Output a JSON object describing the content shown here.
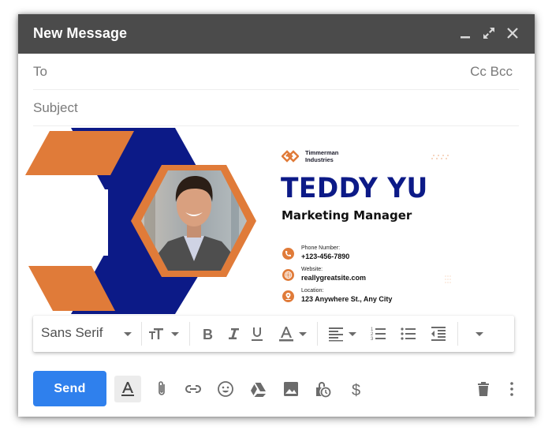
{
  "window": {
    "title": "New Message",
    "controls": [
      "minimize",
      "expand",
      "close"
    ]
  },
  "compose": {
    "to_label": "To",
    "cc_bcc_label": "Cc Bcc",
    "subject_label": "Subject"
  },
  "signature": {
    "company_line1": "Timmerman",
    "company_line2": "Industries",
    "name": "TEDDY YU",
    "role": "Marketing Manager",
    "contacts": [
      {
        "icon": "phone-icon",
        "label": "Phone Number:",
        "value": "+123-456-7890"
      },
      {
        "icon": "globe-icon",
        "label": "Website:",
        "value": "reallygreatsite.com"
      },
      {
        "icon": "location-pin-icon",
        "label": "Location:",
        "value": "123 Anywhere St., Any City"
      }
    ],
    "colors": {
      "navy": "#0c1a87",
      "orange": "#e07b39"
    }
  },
  "format_toolbar": {
    "font_family": "Sans Serif",
    "tools": [
      "font-size",
      "bold",
      "italic",
      "underline",
      "text-color",
      "align",
      "numbered-list",
      "bulleted-list",
      "indent-less",
      "more-formatting"
    ]
  },
  "bottom_bar": {
    "send_label": "Send",
    "send_color": "#2f80ed",
    "tools": [
      "formatting-options",
      "attach-files",
      "insert-link",
      "insert-emoji",
      "insert-drive",
      "insert-photo",
      "confidential-mode",
      "send-money",
      "discard-draft",
      "more-options"
    ]
  }
}
